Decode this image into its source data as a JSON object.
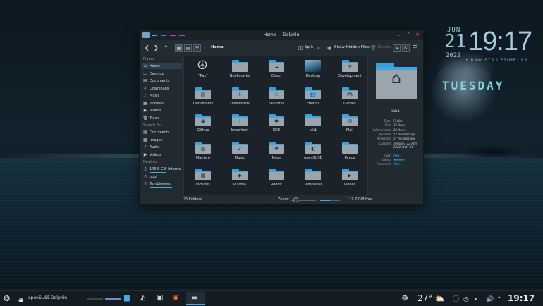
{
  "desktop": {
    "date_month": "JUN",
    "date_day": "21",
    "date_year": "2022",
    "time": "19:17",
    "tagline": "• RAW SYS UPTIME: 9H",
    "weekday": "TUESDAY"
  },
  "window": {
    "title": "Home — Dolphin",
    "accent_dashes": [
      "#3daee9",
      "#5a6cd6",
      "#c33cc6",
      "#9a4fd9"
    ],
    "controls": {
      "minimize": "⌄",
      "maximize": "⌃",
      "close": "×"
    }
  },
  "toolbar": {
    "breadcrumb": "Home",
    "split_label": "Split",
    "hidden_files_label": "Show Hidden Files",
    "delete_label": "Delete"
  },
  "sidebar": {
    "places_title": "Places",
    "places": [
      {
        "label": "Home",
        "icon": "⌂"
      },
      {
        "label": "Desktop",
        "icon": "▭"
      },
      {
        "label": "Documents",
        "icon": "▤"
      },
      {
        "label": "Downloads",
        "icon": "⇩"
      },
      {
        "label": "Music",
        "icon": "♪"
      },
      {
        "label": "Pictures",
        "icon": "▦"
      },
      {
        "label": "Videos",
        "icon": "▶"
      },
      {
        "label": "Trash",
        "icon": "🗑"
      }
    ],
    "search_title": "Search For",
    "search": [
      {
        "label": "Documents",
        "icon": "▤"
      },
      {
        "label": "Images",
        "icon": "▦"
      },
      {
        "label": "Audio",
        "icon": "♪"
      },
      {
        "label": "Videos",
        "icon": "▶"
      }
    ],
    "devices_title": "Devices",
    "devices": [
      {
        "label": "149.5 GiB Interna...",
        "icon": "▯",
        "usage": 0.6
      },
      {
        "label": "boot",
        "icon": "▯",
        "usage": 0.25
      },
      {
        "label": "Tumbleweed",
        "icon": "▯",
        "usage": 0.8
      }
    ]
  },
  "files": [
    {
      "name": "\"Pax\"",
      "glyph": "☮",
      "kind": "pax"
    },
    {
      "name": "Bookmarks",
      "glyph": "",
      "kind": "folder"
    },
    {
      "name": "Cloud",
      "glyph": "☁",
      "kind": "folder"
    },
    {
      "name": "Desktop",
      "glyph": "",
      "kind": "desktop"
    },
    {
      "name": "Development",
      "glyph": "⚒",
      "kind": "folder"
    },
    {
      "name": "Documents",
      "glyph": "▤",
      "kind": "folder"
    },
    {
      "name": "Downloads",
      "glyph": "⇩",
      "kind": "folder"
    },
    {
      "name": "Favorites",
      "glyph": "☆",
      "kind": "folder"
    },
    {
      "name": "Friends",
      "glyph": "👥",
      "kind": "folder"
    },
    {
      "name": "Games",
      "glyph": "🎮",
      "kind": "folder"
    },
    {
      "name": "Github",
      "glyph": "◉",
      "kind": "folder"
    },
    {
      "name": "Important",
      "glyph": "!",
      "kind": "folder"
    },
    {
      "name": "KDE",
      "glyph": "✱",
      "kind": "folder"
    },
    {
      "name": "lak1",
      "glyph": "",
      "kind": "folder"
    },
    {
      "name": "Mail",
      "glyph": "✉",
      "kind": "folder"
    },
    {
      "name": "Manjaro",
      "glyph": "▥",
      "kind": "folder"
    },
    {
      "name": "Music",
      "glyph": "♪",
      "kind": "folder"
    },
    {
      "name": "Neon",
      "glyph": "✺",
      "kind": "folder"
    },
    {
      "name": "openSUSE",
      "glyph": "◐",
      "kind": "folder"
    },
    {
      "name": "Peace",
      "glyph": "",
      "kind": "folder"
    },
    {
      "name": "Pictures",
      "glyph": "▦",
      "kind": "folder"
    },
    {
      "name": "Plasma",
      "glyph": "◆",
      "kind": "folder"
    },
    {
      "name": "Reddit",
      "glyph": "",
      "kind": "folder"
    },
    {
      "name": "Templates",
      "glyph": "",
      "kind": "folder"
    },
    {
      "name": "Videos",
      "glyph": "▶",
      "kind": "folder"
    }
  ],
  "info_panel": {
    "name": "lak1",
    "rows": [
      {
        "k": "Type:",
        "v": "Folder"
      },
      {
        "k": "Size:",
        "v": "25 items"
      },
      {
        "k": "Hidden items:",
        "v": "28 items"
      },
      {
        "k": "Modified:",
        "v": "57 minutes ago"
      },
      {
        "k": "Accessed:",
        "v": "57 minutes ago"
      },
      {
        "k": "Created:",
        "v": "Tuesday, 12 April 2022 at 01:30"
      },
      {
        "k": "Tags:",
        "v": "Add..."
      },
      {
        "k": "Rating:",
        "v": "★★★★★"
      },
      {
        "k": "Comment:",
        "v": "Add..."
      }
    ]
  },
  "statusbar": {
    "folders": "25 Folders",
    "zoom_label": "Zoom:",
    "free_space": "119.7 GiB free",
    "zoom_level": 0.2,
    "space_used": 0.5
  },
  "taskbar": {
    "distro_label": "openSUSE",
    "app_label": "Dolphin",
    "temperature": "27°",
    "clock": "19:17"
  },
  "colors": {
    "accent": "#3daee9",
    "folder": "#9aa5ad",
    "close": "#da4453",
    "minimize": "#c9c74a"
  }
}
